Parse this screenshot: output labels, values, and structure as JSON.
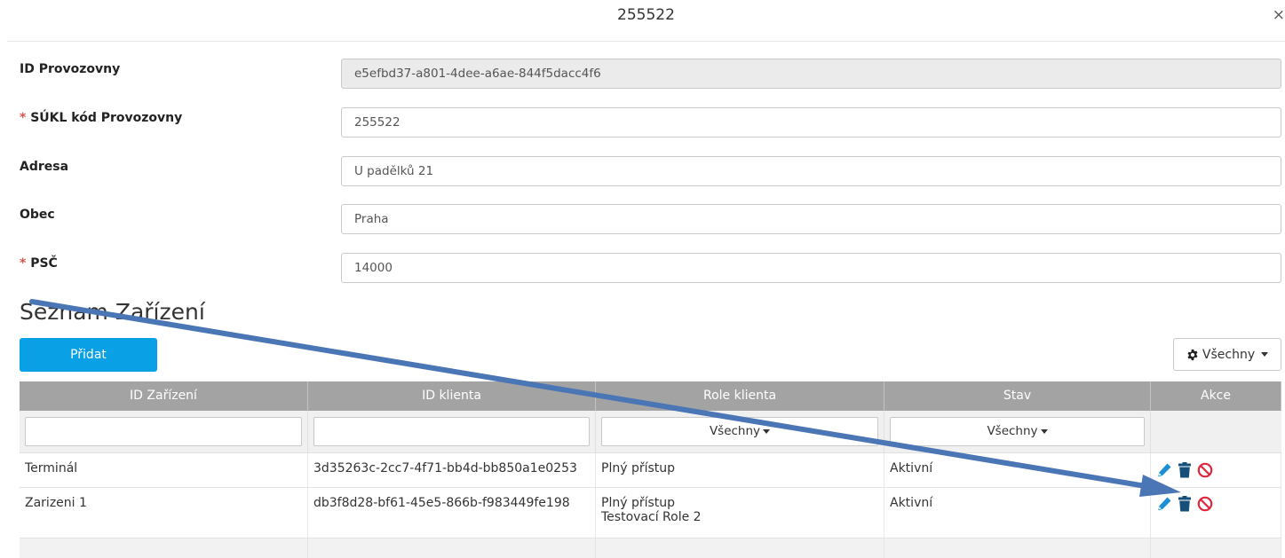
{
  "window": {
    "title": "255522",
    "close_glyph": "×"
  },
  "form": {
    "id_label": "ID Provozovny",
    "id_value": "e5efbd37-a801-4dee-a6ae-844f5dacc4f6",
    "required_mark": "*",
    "sukl_label": "SÚKL kód Provozovny",
    "sukl_value": "255522",
    "address_label": "Adresa",
    "address_value": "U padělků 21",
    "city_label": "Obec",
    "city_value": "Praha",
    "psc_label": "PSČ",
    "psc_value": "14000"
  },
  "devices": {
    "section_title": "Seznam Zařízení",
    "add_label": "Přidat",
    "filter_label": "Všechny",
    "columns": [
      "ID Zařízení",
      "ID klienta",
      "Role klienta",
      "Stav",
      "Akce"
    ],
    "role_filter": "Všechny",
    "state_filter": "Všechny",
    "rows": [
      {
        "device": "Terminál",
        "client_id": "3d35263c-2cc7-4f71-bb4d-bb850a1e0253",
        "roles": [
          "Plný přístup"
        ],
        "state": "Aktivní"
      },
      {
        "device": "Zarizeni 1",
        "client_id": "db3f8d28-bf61-45e5-866b-f983449fe198",
        "roles": [
          "Plný přístup",
          "Testovací Role 2"
        ],
        "state": "Aktivní"
      }
    ]
  },
  "colors": {
    "primary": "#0aa0e6",
    "header": "#a3a3a3",
    "required": "#d9534f",
    "edit_icon": "#1a8fd6",
    "delete_icon": "#16507a",
    "disable_icon": "#e0263c",
    "annotation_arrow": "#4a76b5"
  },
  "icons": [
    "pencil-icon",
    "trash-icon",
    "ban-icon",
    "gear-icon"
  ]
}
